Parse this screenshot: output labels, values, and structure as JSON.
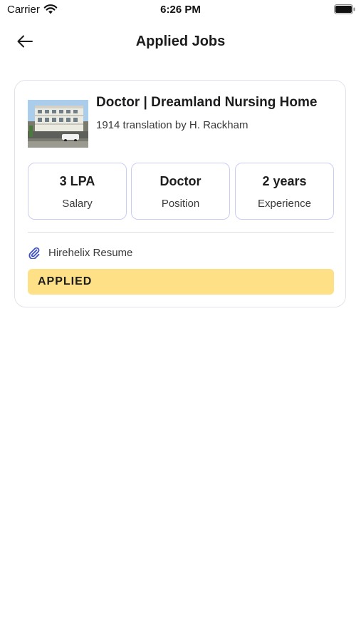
{
  "status_bar": {
    "carrier": "Carrier",
    "time": "6:26 PM",
    "wifi_icon": "wifi-icon",
    "battery_icon": "battery-icon"
  },
  "header": {
    "back_icon": "arrow-left-icon",
    "title": "Applied Jobs"
  },
  "job": {
    "title": "Doctor | Dreamland Nursing Home",
    "subtitle": "1914 translation by H. Rackham",
    "stats": [
      {
        "value": "3 LPA",
        "label": "Salary"
      },
      {
        "value": "Doctor",
        "label": "Position"
      },
      {
        "value": "2 years",
        "label": "Experience"
      }
    ],
    "resume": {
      "icon": "paperclip-icon",
      "label": "Hirehelix Resume"
    },
    "status": "APPLIED"
  },
  "colors": {
    "status_bg": "#fee187",
    "stat_border": "#c9cdf3",
    "clip_icon": "#3d4fc4"
  }
}
